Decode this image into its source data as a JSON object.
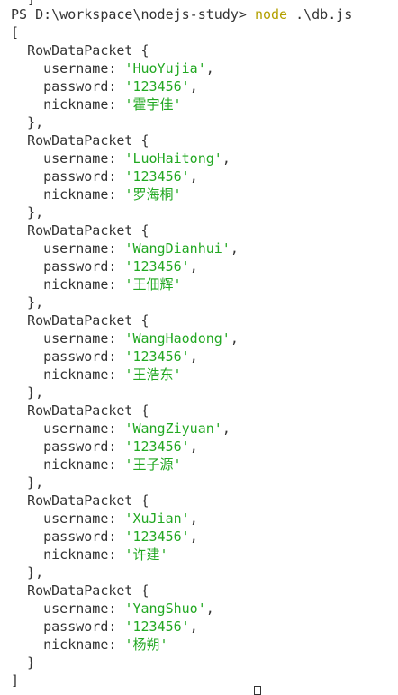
{
  "prompt": {
    "ps": "PS ",
    "path": "D:\\workspace\\nodejs-study>",
    "command": "node",
    "args": " .\\db.js"
  },
  "ghost": "  ] ----",
  "output": {
    "open_bracket": "[",
    "close_bracket": "]",
    "type_name": "RowDataPacket",
    "keys": {
      "username": "username: ",
      "password": "password: ",
      "nickname": "nickname: "
    },
    "rows": [
      {
        "username": "'HuoYujia'",
        "password": "'123456'",
        "nickname": "'霍宇佳'"
      },
      {
        "username": "'LuoHaitong'",
        "password": "'123456'",
        "nickname": "'罗海桐'"
      },
      {
        "username": "'WangDianhui'",
        "password": "'123456'",
        "nickname": "'王佃辉'"
      },
      {
        "username": "'WangHaodong'",
        "password": "'123456'",
        "nickname": "'王浩东'"
      },
      {
        "username": "'WangZiyuan'",
        "password": "'123456'",
        "nickname": "'王子源'"
      },
      {
        "username": "'XuJian'",
        "password": "'123456'",
        "nickname": "'许建'"
      },
      {
        "username": "'YangShuo'",
        "password": "'123456'",
        "nickname": "'杨朔'"
      }
    ]
  },
  "colors": {
    "string": "#22a822",
    "command": "#b3a000",
    "text": "#333333"
  }
}
